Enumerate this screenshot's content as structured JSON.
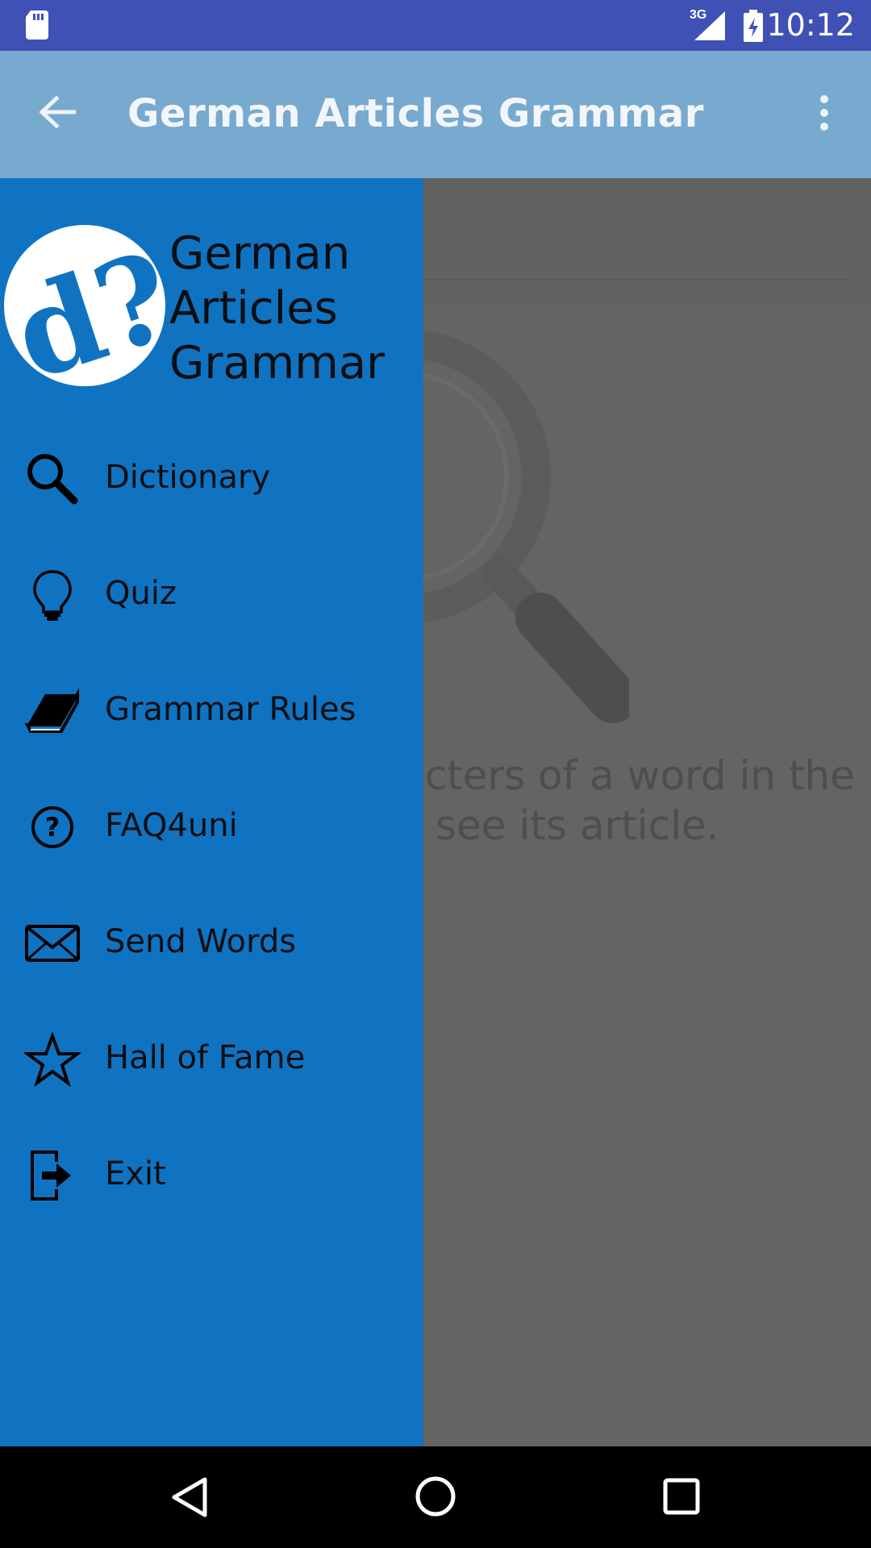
{
  "status_bar": {
    "time": "10:12",
    "network": "3G",
    "icons": [
      "sd-card-icon",
      "signal-icon",
      "battery-charging-icon"
    ]
  },
  "app_bar": {
    "title": "German Articles Grammar",
    "back_icon": "arrow-back-icon",
    "menu_icon": "more-vert-icon"
  },
  "background": {
    "hint_line1": "racters of a word in the",
    "hint_line2": "see its article."
  },
  "drawer": {
    "title_lines": [
      "German",
      "Articles",
      "Grammar"
    ],
    "items": [
      {
        "label": "Dictionary",
        "icon": "search-icon"
      },
      {
        "label": "Quiz",
        "icon": "lightbulb-icon"
      },
      {
        "label": "Grammar Rules",
        "icon": "book-icon"
      },
      {
        "label": "FAQ4uni",
        "icon": "help-circle-icon"
      },
      {
        "label": "Send Words",
        "icon": "mail-icon"
      },
      {
        "label": "Hall of Fame",
        "icon": "star-icon"
      },
      {
        "label": "Exit",
        "icon": "exit-icon"
      }
    ]
  },
  "colors": {
    "status_bar": "#3f51b5",
    "app_bar_dimmed": "#78a9cf",
    "drawer": "#1073c1",
    "scrim": "#646464"
  }
}
